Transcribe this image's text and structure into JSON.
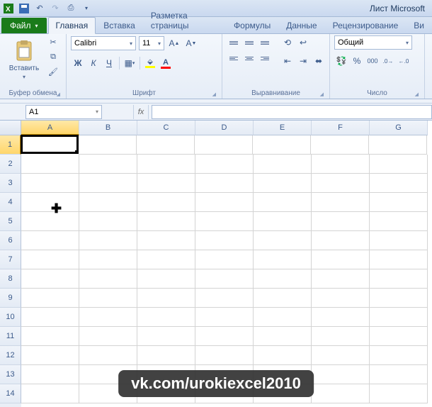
{
  "title": "Лист Microsoft",
  "tabs": {
    "file": "Файл",
    "home": "Главная",
    "insert": "Вставка",
    "layout": "Разметка страницы",
    "formulas": "Формулы",
    "data": "Данные",
    "review": "Рецензирование",
    "view": "Ви"
  },
  "ribbon": {
    "clipboard": {
      "label": "Буфер обмена",
      "paste": "Вставить"
    },
    "font": {
      "label": "Шрифт",
      "name": "Calibri",
      "size": "11",
      "bold": "Ж",
      "italic": "К",
      "underline": "Ч"
    },
    "alignment": {
      "label": "Выравнивание"
    },
    "number": {
      "label": "Число",
      "format": "Общий"
    }
  },
  "namebox": "A1",
  "columns": [
    "A",
    "B",
    "C",
    "D",
    "E",
    "F",
    "G"
  ],
  "rows": [
    "1",
    "2",
    "3",
    "4",
    "5",
    "6",
    "7",
    "8",
    "9",
    "10",
    "11",
    "12",
    "13",
    "14"
  ],
  "selected": {
    "row": 0,
    "col": 0
  },
  "watermark": "vk.com/urokiexcel2010"
}
